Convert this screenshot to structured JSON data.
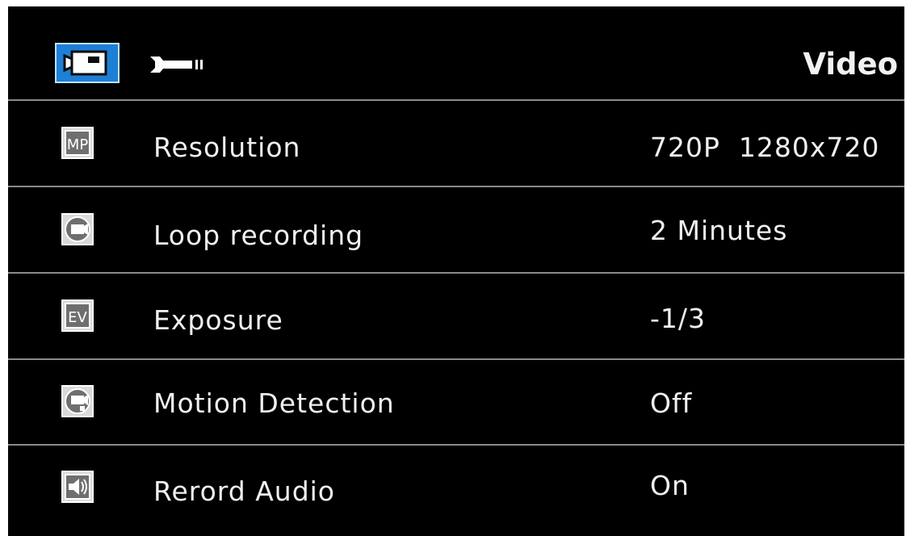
{
  "header": {
    "title": "Video",
    "tabs": [
      {
        "icon": "video-camera-icon",
        "selected": true
      },
      {
        "icon": "wrench-icon",
        "selected": false
      }
    ]
  },
  "menu": {
    "items": [
      {
        "icon": "mp-icon",
        "icon_text": "MP",
        "label": "Resolution",
        "value": "720P  1280x720"
      },
      {
        "icon": "loop-recording-icon",
        "label": "Loop recording",
        "value": "2 Minutes"
      },
      {
        "icon": "ev-icon",
        "icon_text": "EV",
        "label": "Exposure",
        "value": "-1/3"
      },
      {
        "icon": "motion-detection-icon",
        "label": "Motion Detection",
        "value": "Off"
      },
      {
        "icon": "speaker-icon",
        "label": "Rerord Audio",
        "value": "On"
      }
    ]
  },
  "colors": {
    "background": "#000000",
    "selected_tab": "#1e7fd6",
    "divider": "#8a8a8a",
    "text": "#f0f0f0"
  }
}
